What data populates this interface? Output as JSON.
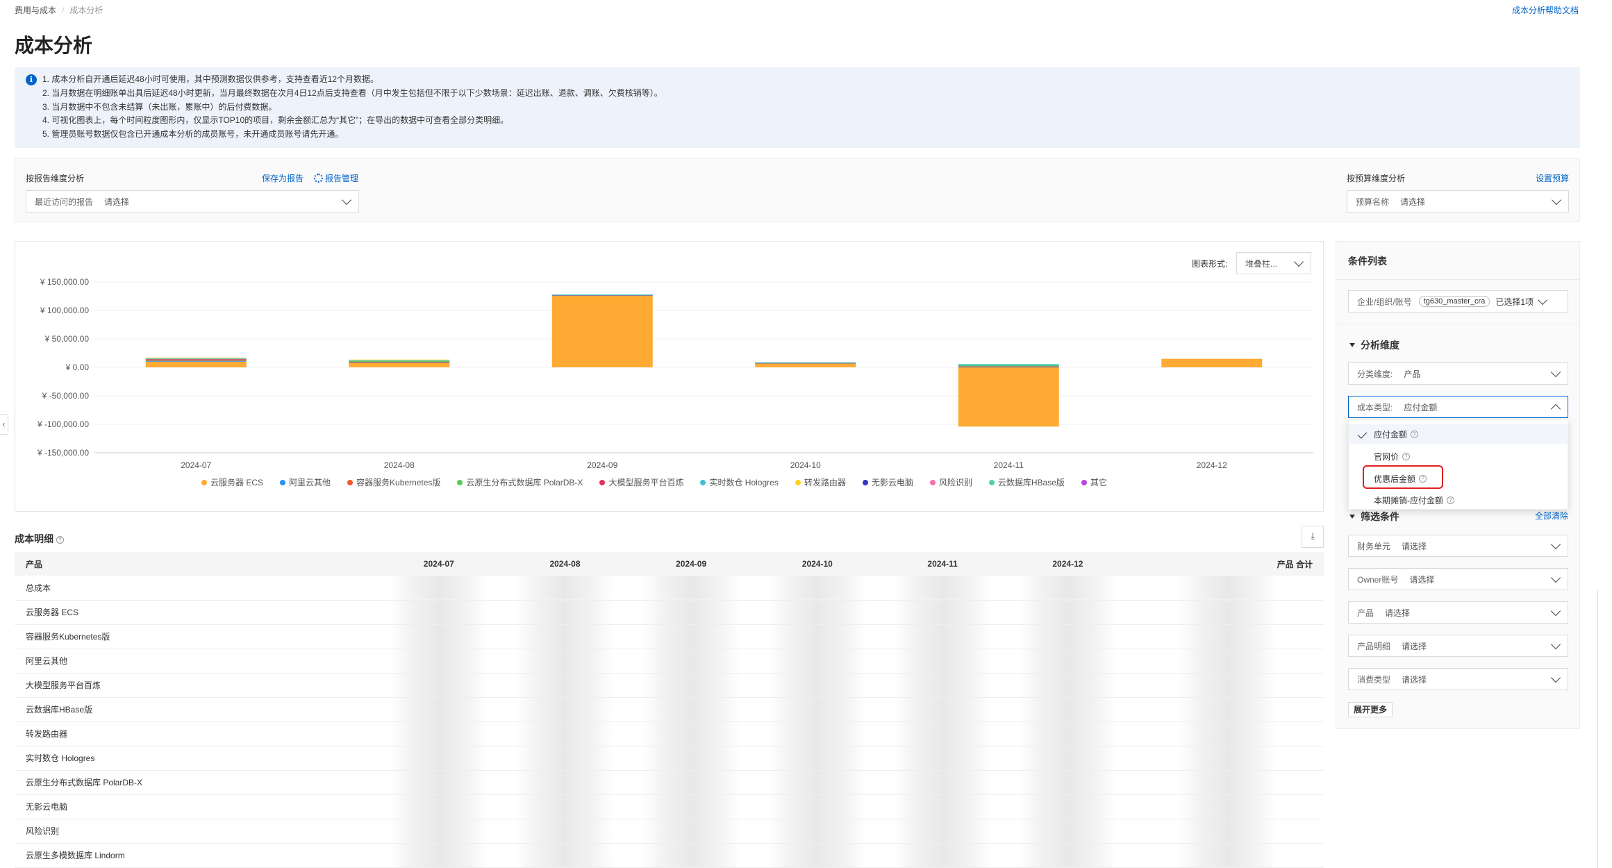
{
  "breadcrumb": {
    "parent": "费用与成本",
    "current": "成本分析"
  },
  "help_link": "成本分析帮助文档",
  "page_title": "成本分析",
  "notice": [
    "1. 成本分析自开通后延迟48小时可使用，其中预测数据仅供参考，支持查看近12个月数据。",
    "2. 当月数据在明细账单出具后延迟48小时更新，当月最终数据在次月4日12点后支持查看（月中发生包括但不限于以下少数场景：延迟出账、退款、调账、欠费核销等）。",
    "3. 当月数据中不包含未结算（未出账，累账中）的后付费数据。",
    "4. 可视化图表上，每个时间粒度图形内，仅显示TOP10的项目，剩余金额汇总为“其它”；在导出的数据中可查看全部分类明细。",
    "5. 管理员账号数据仅包含已开通成本分析的成员账号，未开通成员账号请先开通。"
  ],
  "report": {
    "label": "按报告维度分析",
    "save_link": "保存为报告",
    "manage_link": "报告管理",
    "recent_label": "最近访问的报告",
    "recent_value": "请选择"
  },
  "budget": {
    "label": "按预算维度分析",
    "set_link": "设置预算",
    "name_label": "预算名称",
    "name_value": "请选择"
  },
  "chart_form": {
    "label": "图表形式:",
    "value": "堆叠柱..."
  },
  "chart_data": {
    "type": "bar",
    "stacked": true,
    "categories": [
      "2024-07",
      "2024-08",
      "2024-09",
      "2024-10",
      "2024-11",
      "2024-12"
    ],
    "y_ticks": [
      "¥ 150,000.00",
      "¥ 100,000.00",
      "¥ 50,000.00",
      "¥ 0.00",
      "¥ -50,000.00",
      "¥ -100,000.00",
      "¥ -150,000.00"
    ],
    "ylim": [
      -150000,
      150000
    ],
    "series": [
      {
        "name": "云服务器 ECS",
        "color": "#ffaa33",
        "values": [
          10000,
          8000,
          126000,
          7000,
          -104000,
          15000
        ]
      },
      {
        "name": "阿里云其他",
        "color": "#2c8ef8",
        "values": [
          1500,
          1000,
          800,
          800,
          1000,
          0
        ]
      },
      {
        "name": "容器服务Kubernetes版",
        "color": "#f05a28",
        "values": [
          1000,
          800,
          600,
          500,
          800,
          0
        ]
      },
      {
        "name": "云原生分布式数据库 PolarDB-X",
        "color": "#5cc95c",
        "values": [
          1500,
          1500,
          0,
          0,
          1500,
          0
        ]
      },
      {
        "name": "大模型服务平台百炼",
        "color": "#e5335b",
        "values": [
          500,
          0,
          0,
          0,
          0,
          0
        ]
      },
      {
        "name": "实时数仓 Hologres",
        "color": "#3fc1d0",
        "values": [
          1500,
          1500,
          500,
          500,
          1000,
          0
        ]
      },
      {
        "name": "转发路由器",
        "color": "#ffd21e",
        "values": [
          800,
          800,
          0,
          0,
          0,
          0
        ]
      },
      {
        "name": "无影云电脑",
        "color": "#3732c8",
        "values": [
          0,
          0,
          0,
          0,
          0,
          0
        ]
      },
      {
        "name": "风险识别",
        "color": "#f570b0",
        "values": [
          0,
          0,
          0,
          0,
          0,
          0
        ]
      },
      {
        "name": "云数据库HBase版",
        "color": "#4fd1a8",
        "values": [
          0,
          0,
          0,
          0,
          1500,
          0
        ]
      },
      {
        "name": "其它",
        "color": "#bb44dd",
        "values": [
          0,
          0,
          0,
          0,
          0,
          0
        ]
      }
    ]
  },
  "conditions": {
    "title": "条件列表",
    "account_label": "企业/组织/账号",
    "account_value": "tg630_master_cra",
    "account_selected": "已选择1项",
    "analysis_title": "分析维度",
    "category_label": "分类维度:",
    "category_value": "产品",
    "cost_type_label": "成本类型:",
    "cost_type_value": "应付金额",
    "cost_type_options": [
      "应付金额",
      "官网价",
      "优惠后金额",
      "本期摊销-应付金额"
    ],
    "filter_title": "筛选条件",
    "clear_all": "全部清除",
    "filters": [
      {
        "label": "财务单元",
        "value": "请选择"
      },
      {
        "label": "Owner账号",
        "value": "请选择"
      },
      {
        "label": "产品",
        "value": "请选择"
      },
      {
        "label": "产品明细",
        "value": "请选择"
      },
      {
        "label": "消费类型",
        "value": "请选择"
      }
    ],
    "expand_more": "展开更多"
  },
  "detail": {
    "title": "成本明细",
    "columns": [
      "产品",
      "2024-07",
      "2024-08",
      "2024-09",
      "2024-10",
      "2024-11",
      "2024-12",
      "产品 合计"
    ],
    "rows": [
      "总成本",
      "云服务器 ECS",
      "容器服务Kubernetes版",
      "阿里云其他",
      "大模型服务平台百炼",
      "云数据库HBase版",
      "转发路由器",
      "实时数仓 Hologres",
      "云原生分布式数据库 PolarDB-X",
      "无影云电脑",
      "风险识别",
      "云原生多模数据库 Lindorm"
    ]
  }
}
